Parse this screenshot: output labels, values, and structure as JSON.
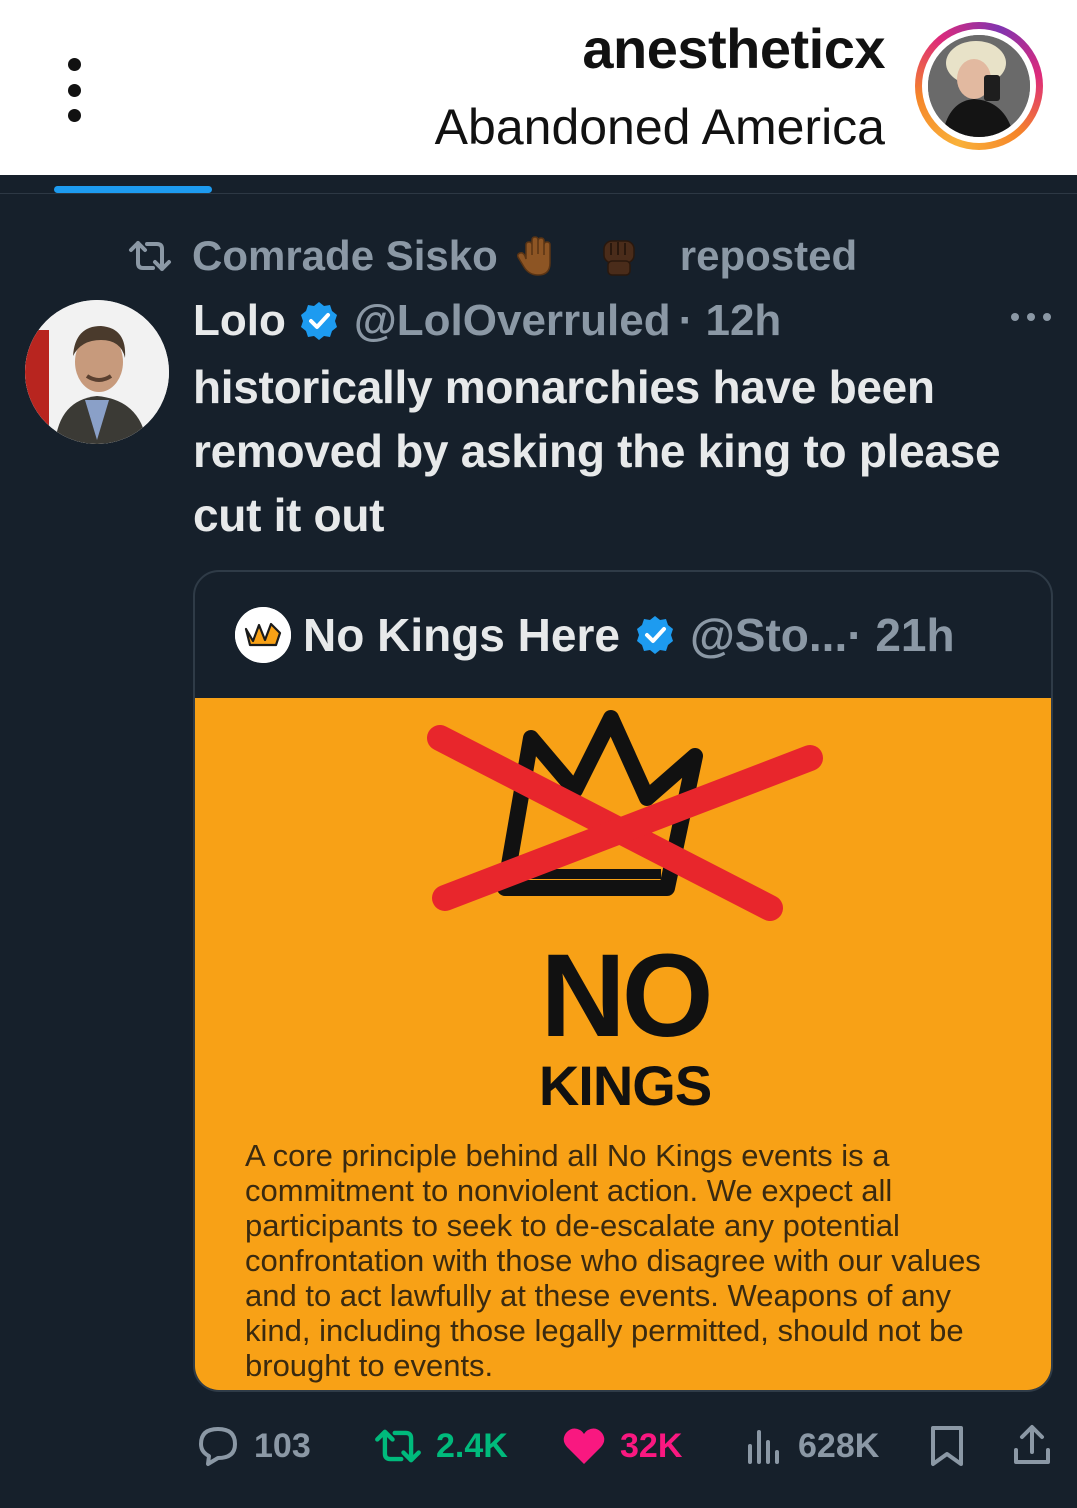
{
  "header": {
    "username": "anestheticx",
    "subtitle": "Abandoned America"
  },
  "repost": {
    "reposter": "Comrade Sisko",
    "label": "reposted",
    "emojis": [
      "raised-hand-emoji",
      "raised-fist-emoji"
    ]
  },
  "tweet": {
    "name": "Lolo",
    "handle": "@LolOverruled",
    "time": "· 12h",
    "text": "historically monarchies have been removed by asking the king to please cut it out"
  },
  "quote": {
    "name": "No Kings Here",
    "handle": "@Sto... ",
    "time": "· 21h",
    "image": {
      "headline_no": "NO",
      "headline_kings": "KINGS",
      "body": "A core principle behind all No Kings events is a commitment to nonviolent action. We expect all participants to seek to de-escalate any potential confrontation with those who disagree with our values and to act lawfully at these events. Weapons of any kind, including those legally permitted, should not be brought to events."
    }
  },
  "actions": {
    "replies": "103",
    "reposts": "2.4K",
    "likes": "32K",
    "views": "628K"
  },
  "colors": {
    "background": "#16202b",
    "accent_blue": "#1d9bf0",
    "repost_green": "#00ba7c",
    "like_pink": "#f91880",
    "secondary_text": "#8b98a5",
    "no_kings_orange": "#f8a116",
    "cross_red": "#e8262c"
  },
  "icons": [
    "menu-dots-icon",
    "repost-icon",
    "verified-icon",
    "more-icon",
    "reply-icon",
    "like-icon",
    "views-icon",
    "bookmark-icon",
    "share-icon"
  ]
}
